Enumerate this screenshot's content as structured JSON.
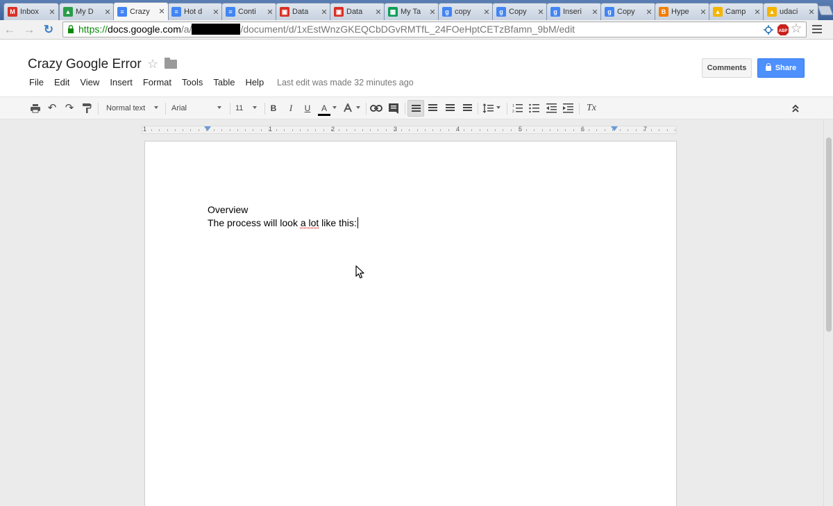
{
  "browser": {
    "tabs": [
      {
        "title": "Inbox",
        "icon": "gmail-icon",
        "color": "#d93025",
        "glyph": "M"
      },
      {
        "title": "My D",
        "icon": "drive-icon",
        "color": "#2a9d4a",
        "glyph": "▲"
      },
      {
        "title": "Crazy",
        "icon": "docs-icon",
        "color": "#4285f4",
        "glyph": "≡",
        "active": true
      },
      {
        "title": "Hot d",
        "icon": "docs-icon",
        "color": "#4285f4",
        "glyph": "≡"
      },
      {
        "title": "Conti",
        "icon": "docs-icon",
        "color": "#4285f4",
        "glyph": "≡"
      },
      {
        "title": "Data",
        "icon": "slides-icon",
        "color": "#d93025",
        "glyph": "▣"
      },
      {
        "title": "Data",
        "icon": "slides-icon",
        "color": "#d93025",
        "glyph": "▣"
      },
      {
        "title": "My Ta",
        "icon": "sheets-icon",
        "color": "#0f9d58",
        "glyph": "▦"
      },
      {
        "title": "copy",
        "icon": "google-search-icon",
        "color": "#4285f4",
        "glyph": "g"
      },
      {
        "title": "Copy",
        "icon": "google-search-icon",
        "color": "#4285f4",
        "glyph": "g"
      },
      {
        "title": "Inseri",
        "icon": "google-search-icon",
        "color": "#4285f4",
        "glyph": "g"
      },
      {
        "title": "Copy",
        "icon": "google-search-icon",
        "color": "#4285f4",
        "glyph": "g"
      },
      {
        "title": "Hype",
        "icon": "blogger-icon",
        "color": "#f57d00",
        "glyph": "B"
      },
      {
        "title": "Camp",
        "icon": "camp-icon",
        "color": "#f4b400",
        "glyph": "▲"
      },
      {
        "title": "udaci",
        "icon": "udacity-icon",
        "color": "#f4b400",
        "glyph": "▲"
      }
    ],
    "url": {
      "scheme": "https://",
      "host": "docs.google.com",
      "path_prefix": "/a/",
      "path_rest": "/document/d/1xEstWnzGKEQCbDGvRMTfL_24FOeHptCETzBfamn_9bM/edit"
    }
  },
  "docs": {
    "title": "Crazy Google Error",
    "menu": [
      "File",
      "Edit",
      "View",
      "Insert",
      "Format",
      "Tools",
      "Table",
      "Help"
    ],
    "last_edit": "Last edit was made 32 minutes ago",
    "comments_label": "Comments",
    "share_label": "Share",
    "toolbar": {
      "style": "Normal text",
      "font": "Arial",
      "size": "11",
      "bold": "B",
      "italic": "I",
      "underline": "U",
      "text_color": "A",
      "clear": "Tx"
    },
    "ruler_numbers": [
      "1",
      "1",
      "2",
      "3",
      "4",
      "5",
      "6",
      "7"
    ],
    "content": {
      "line1": "Overview",
      "line2_before": "The process will look ",
      "line2_spell": "a lot",
      "line2_after": " like this:"
    }
  },
  "colors": {
    "share_blue": "#4d90fe",
    "url_green": "#0a8a0a"
  }
}
